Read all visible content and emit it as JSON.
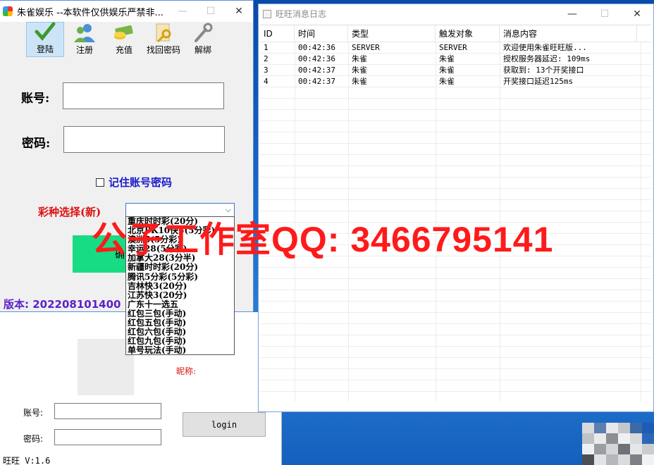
{
  "main_window": {
    "title": "朱雀娱乐 --本软件仅供娱乐严禁非...",
    "toolbar": [
      {
        "label": "登陆",
        "icon": "check-icon"
      },
      {
        "label": "注册",
        "icon": "users-icon"
      },
      {
        "label": "充值",
        "icon": "money-icon"
      },
      {
        "label": "找回密码",
        "icon": "key-icon"
      },
      {
        "label": "解绑",
        "icon": "wrench-icon"
      }
    ],
    "account_label": "账号:",
    "password_label": "密码:",
    "remember_label": "记住账号密码",
    "lottery_label": "彩种选择(新)",
    "confirm_label": "确",
    "version": "版本: 202208101400",
    "dropdown_options": [
      "重庆时时彩(20分)",
      "北京PK10快5(5分彩)",
      "澳洲5(5分彩)",
      "幸运28(5分彩)",
      "加拿大28(3分半)",
      "新疆时时彩(20分)",
      "腾讯5分彩(5分彩)",
      "吉林快3(20分)",
      "江苏快3(20分)",
      "广东十一选五",
      "红包三包(手动)",
      "红包五包(手动)",
      "红包六包(手动)",
      "红包九包(手动)",
      "单号玩法(手动)"
    ]
  },
  "ww_window": {
    "nick_label": "昵称:",
    "account_label": "账号:",
    "password_label": "密码:",
    "login_label": "login",
    "version": "旺旺 V:1.6"
  },
  "log_window": {
    "title": "旺旺消息日志",
    "columns": [
      "ID",
      "时间",
      "类型",
      "触发对象",
      "消息内容"
    ],
    "rows": [
      {
        "id": "1",
        "time": "00:42:36",
        "type": "SERVER",
        "target": "SERVER",
        "msg": "欢迎使用朱雀旺旺版..."
      },
      {
        "id": "2",
        "time": "00:42:36",
        "type": "朱雀",
        "target": "朱雀",
        "msg": "授权服务器延迟: 109ms"
      },
      {
        "id": "3",
        "time": "00:42:37",
        "type": "朱雀",
        "target": "朱雀",
        "msg": "获取到: 13个开奖接口"
      },
      {
        "id": "4",
        "time": "00:42:37",
        "type": "朱雀",
        "target": "朱雀",
        "msg": "开奖接口延迟125ms"
      }
    ]
  },
  "watermark": "公子工作室QQ: 3466795141",
  "colors": {
    "accent_green": "#18dc84",
    "label_red": "#d11111",
    "version_purple": "#5a22c8",
    "watermark_red": "#ff1a1a"
  }
}
